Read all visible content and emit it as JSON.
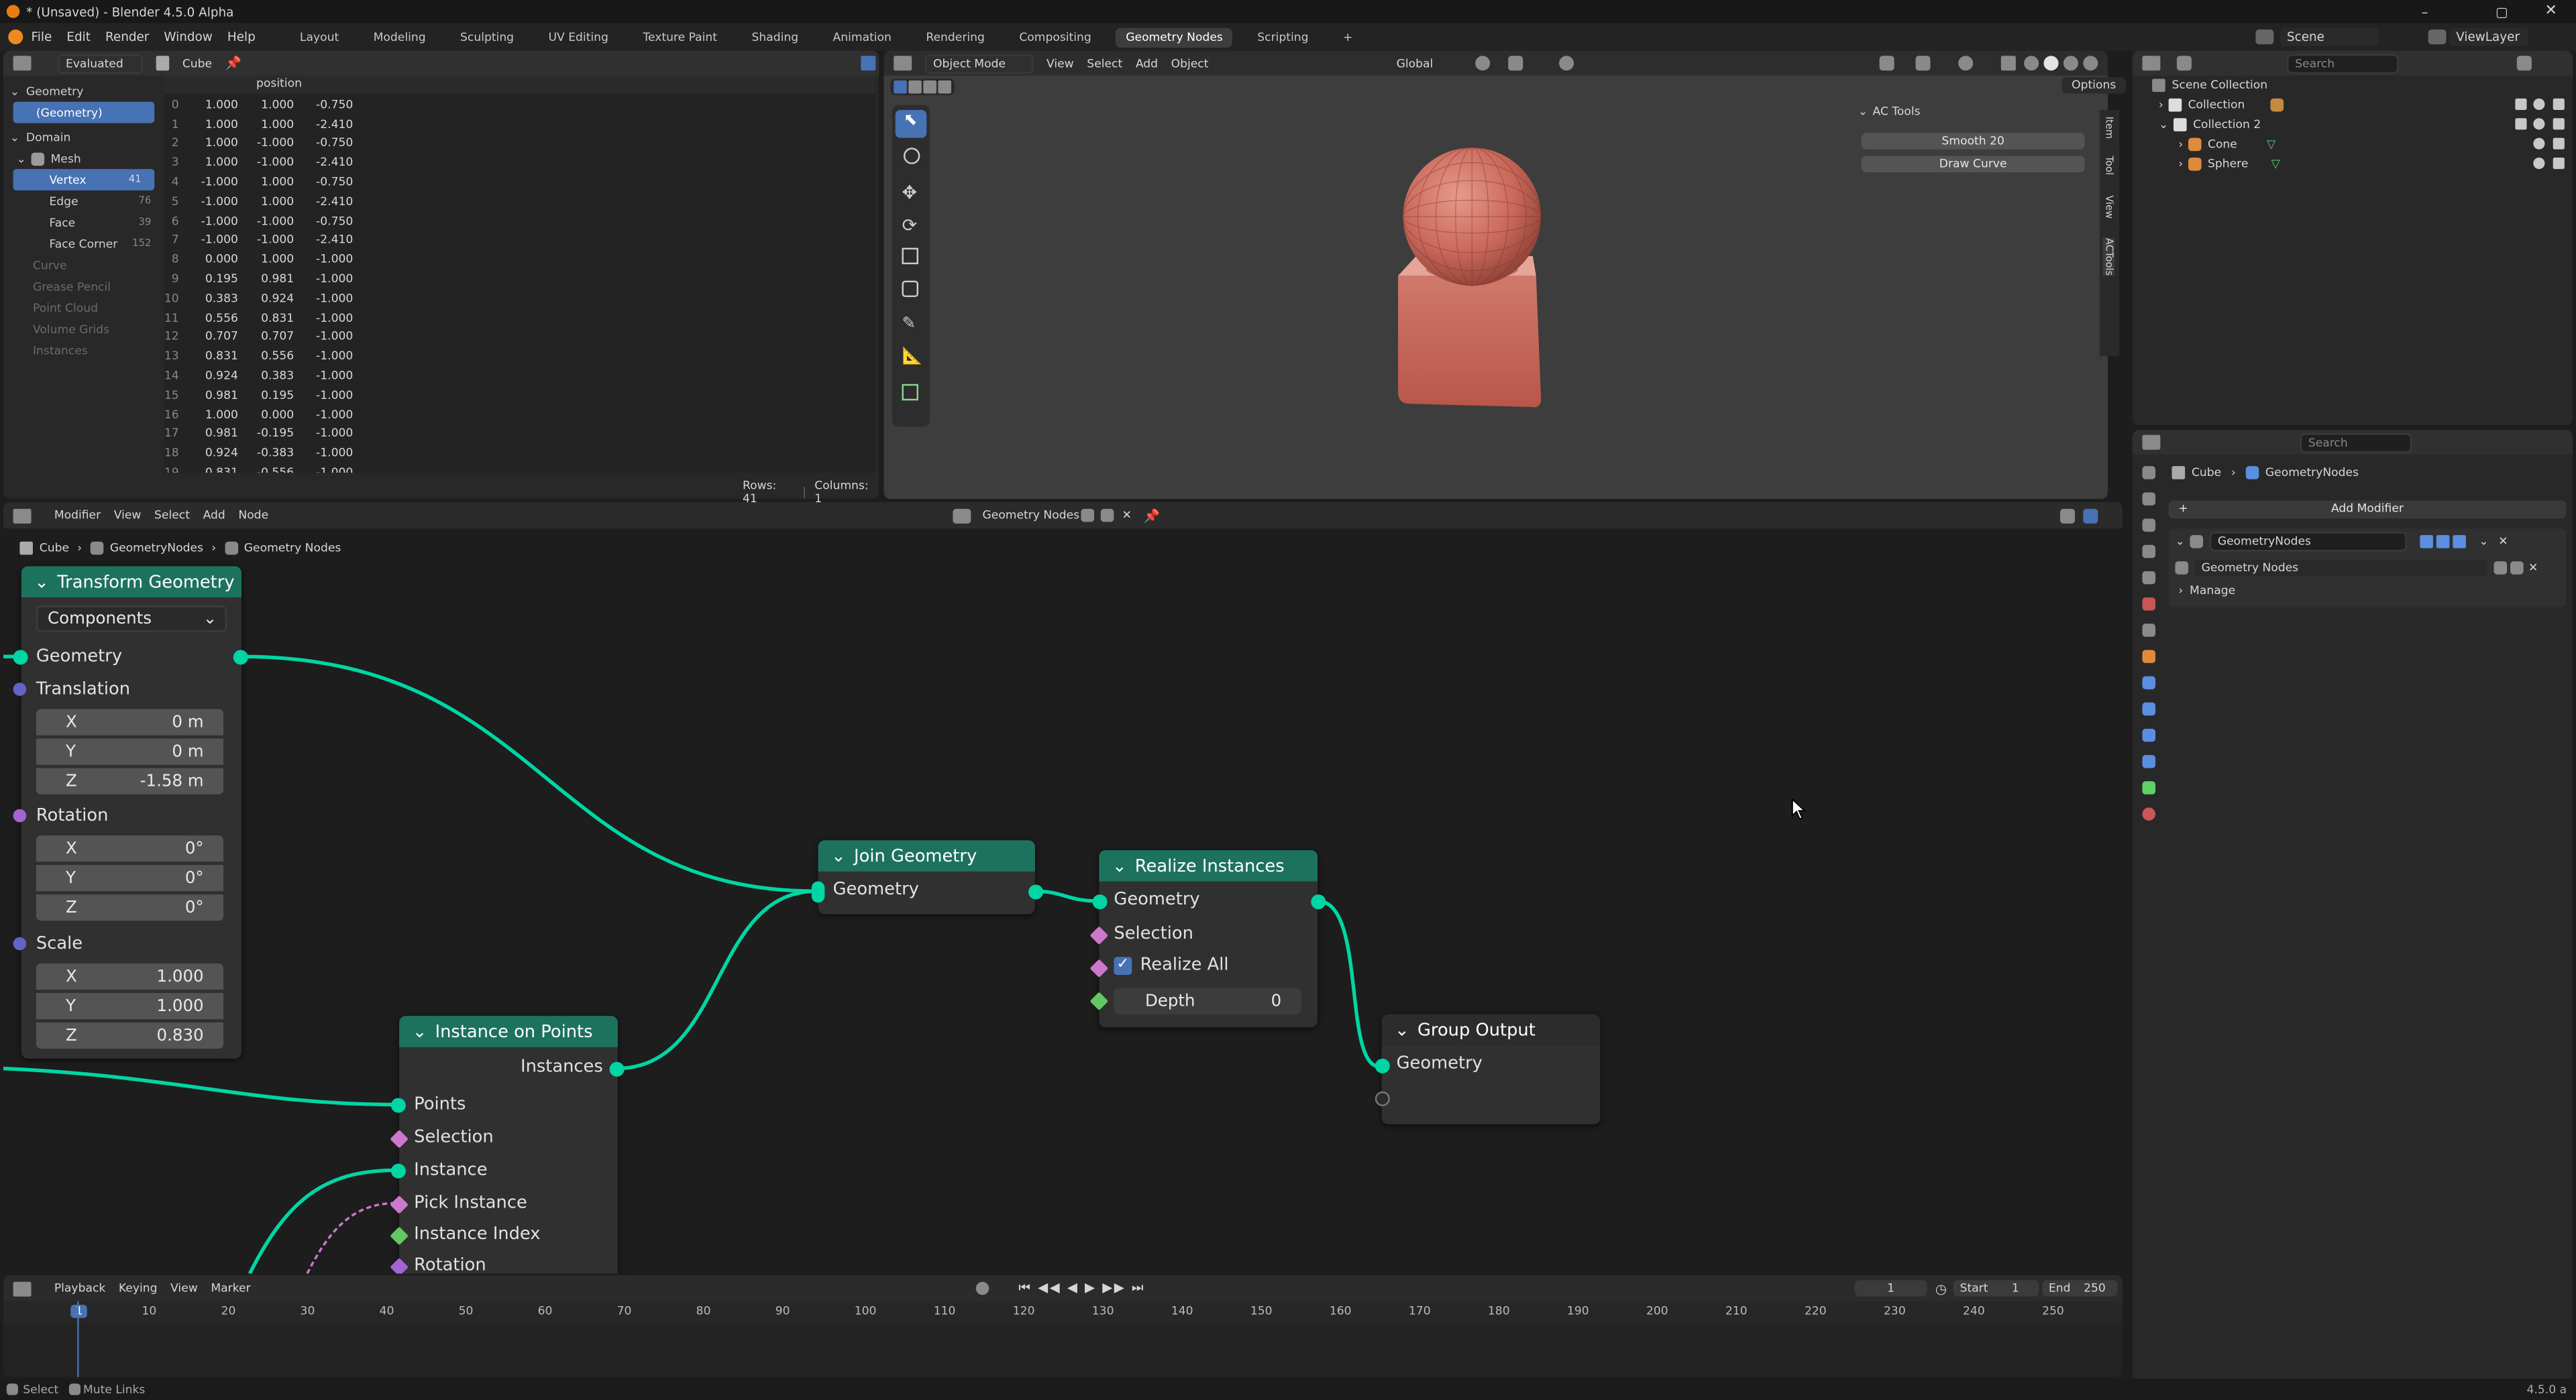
{
  "window": {
    "title": "* (Unsaved) - Blender 4.5.0 Alpha"
  },
  "menu": {
    "items": [
      "File",
      "Edit",
      "Render",
      "Window",
      "Help"
    ],
    "workspaces": [
      "Layout",
      "Modeling",
      "Sculpting",
      "UV Editing",
      "Texture Paint",
      "Shading",
      "Animation",
      "Rendering",
      "Compositing",
      "Geometry Nodes",
      "Scripting"
    ],
    "active_workspace": "Geometry Nodes",
    "scene": "Scene",
    "view_layer": "ViewLayer"
  },
  "spreadsheet": {
    "mode": "Evaluated",
    "object": "Cube",
    "tree": {
      "geometry_header": "Geometry",
      "geometry_item": "(Geometry)",
      "domain_header": "Domain",
      "mesh": "Mesh",
      "items": [
        {
          "label": "Vertex",
          "count": "41"
        },
        {
          "label": "Edge",
          "count": "76"
        },
        {
          "label": "Face",
          "count": "39"
        },
        {
          "label": "Face Corner",
          "count": "152"
        }
      ],
      "other": [
        "Curve",
        "Grease Pencil",
        "Point Cloud",
        "Volume Grids",
        "Instances"
      ]
    },
    "column": "position",
    "rows": [
      [
        "0",
        "1.000",
        "1.000",
        "-0.750"
      ],
      [
        "1",
        "1.000",
        "1.000",
        "-2.410"
      ],
      [
        "2",
        "1.000",
        "-1.000",
        "-0.750"
      ],
      [
        "3",
        "1.000",
        "-1.000",
        "-2.410"
      ],
      [
        "4",
        "-1.000",
        "1.000",
        "-0.750"
      ],
      [
        "5",
        "-1.000",
        "1.000",
        "-2.410"
      ],
      [
        "6",
        "-1.000",
        "-1.000",
        "-0.750"
      ],
      [
        "7",
        "-1.000",
        "-1.000",
        "-2.410"
      ],
      [
        "8",
        "0.000",
        "1.000",
        "-1.000"
      ],
      [
        "9",
        "0.195",
        "0.981",
        "-1.000"
      ],
      [
        "10",
        "0.383",
        "0.924",
        "-1.000"
      ],
      [
        "11",
        "0.556",
        "0.831",
        "-1.000"
      ],
      [
        "12",
        "0.707",
        "0.707",
        "-1.000"
      ],
      [
        "13",
        "0.831",
        "0.556",
        "-1.000"
      ],
      [
        "14",
        "0.924",
        "0.383",
        "-1.000"
      ],
      [
        "15",
        "0.981",
        "0.195",
        "-1.000"
      ],
      [
        "16",
        "1.000",
        "0.000",
        "-1.000"
      ],
      [
        "17",
        "0.981",
        "-0.195",
        "-1.000"
      ],
      [
        "18",
        "0.924",
        "-0.383",
        "-1.000"
      ],
      [
        "19",
        "0.831",
        "-0.556",
        "-1.000"
      ]
    ],
    "footer_rows": "Rows: 41",
    "footer_cols": "Columns: 1"
  },
  "viewport": {
    "mode": "Object Mode",
    "menus": [
      "View",
      "Select",
      "Add",
      "Object"
    ],
    "orientation": "Global",
    "options": "Options",
    "ac_tools": {
      "title": "AC Tools",
      "buttons": [
        "Smooth 20",
        "Draw Curve"
      ]
    },
    "side_tabs": [
      "Item",
      "Tool",
      "View",
      "ACTools"
    ]
  },
  "outliner": {
    "search": "Search",
    "root": "Scene Collection",
    "items": [
      "Collection",
      "Collection 2",
      "Cone",
      "Sphere"
    ]
  },
  "properties": {
    "search": "Search",
    "breadcrumb": [
      "Cube",
      "GeometryNodes"
    ],
    "add_modifier": "Add Modifier",
    "modifier_name": "GeometryNodes",
    "node_group": "Geometry Nodes",
    "manage": "Manage"
  },
  "node_editor": {
    "menus": [
      "Modifier",
      "View",
      "Select",
      "Add",
      "Node"
    ],
    "tree_name": "Geometry Nodes",
    "breadcrumb": [
      "Cube",
      "GeometryNodes",
      "Geometry Nodes"
    ],
    "transform": {
      "title": "Transform Geometry",
      "mode": "Components",
      "geometry": "Geometry",
      "translation": "Translation",
      "rotation": "Rotation",
      "scale": "Scale",
      "tx": {
        "k": "X",
        "v": "0 m"
      },
      "ty": {
        "k": "Y",
        "v": "0 m"
      },
      "tz": {
        "k": "Z",
        "v": "-1.58 m"
      },
      "rx": {
        "k": "X",
        "v": "0°"
      },
      "ry": {
        "k": "Y",
        "v": "0°"
      },
      "rz": {
        "k": "Z",
        "v": "0°"
      },
      "sx": {
        "k": "X",
        "v": "1.000"
      },
      "sy": {
        "k": "Y",
        "v": "1.000"
      },
      "sz": {
        "k": "Z",
        "v": "0.830"
      }
    },
    "join": {
      "title": "Join Geometry",
      "geometry": "Geometry"
    },
    "realize": {
      "title": "Realize Instances",
      "geometry": "Geometry",
      "selection": "Selection",
      "realize_all": "Realize All",
      "depth_label": "Depth",
      "depth_value": "0"
    },
    "output": {
      "title": "Group Output",
      "geometry": "Geometry"
    },
    "instance": {
      "title": "Instance on Points",
      "instances": "Instances",
      "points": "Points",
      "selection": "Selection",
      "instance": "Instance",
      "pick": "Pick Instance",
      "index": "Instance Index",
      "rotation": "Rotation"
    }
  },
  "timeline": {
    "menus": [
      "Playback",
      "Keying",
      "View",
      "Marker"
    ],
    "current_frame": "1",
    "start_label": "Start",
    "start": "1",
    "end_label": "End",
    "end": "250",
    "ticks": [
      "1",
      "10",
      "20",
      "30",
      "40",
      "50",
      "60",
      "70",
      "80",
      "90",
      "100",
      "110",
      "120",
      "130",
      "140",
      "150",
      "160",
      "170",
      "180",
      "190",
      "200",
      "210",
      "220",
      "230",
      "240",
      "250"
    ]
  },
  "statusbar": {
    "select": "Select",
    "mute": "Mute Links",
    "version": "4.5.0 a"
  }
}
